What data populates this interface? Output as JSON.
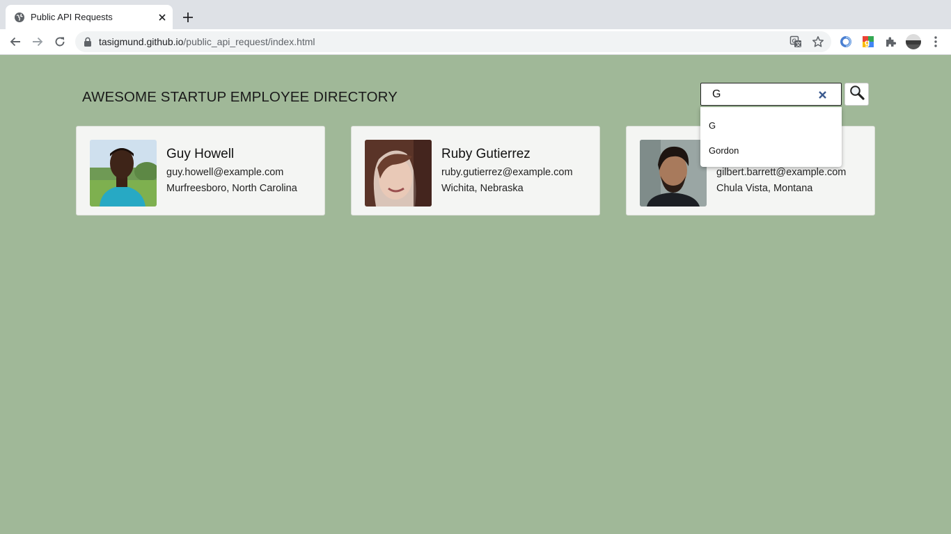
{
  "browser": {
    "tab_title": "Public API Requests",
    "url_host": "tasigmund.github.io",
    "url_path": "/public_api_request/index.html"
  },
  "page": {
    "title": "AWESOME STARTUP EMPLOYEE DIRECTORY",
    "search": {
      "value": "G",
      "suggestions": [
        "G",
        "Gordon"
      ]
    },
    "employees": [
      {
        "name": "Guy Howell",
        "email": "guy.howell@example.com",
        "location": "Murfreesboro, North Carolina"
      },
      {
        "name": "Ruby Gutierrez",
        "email": "ruby.gutierrez@example.com",
        "location": "Wichita, Nebraska"
      },
      {
        "name": "",
        "email": "gilbert.barrett@example.com",
        "location": "Chula Vista, Montana"
      }
    ]
  },
  "colors": {
    "page_background": "#a0b898",
    "card_background": "#f4f5f3",
    "tabstrip": "#dee1e6"
  },
  "icons": [
    "globe-icon",
    "close-icon",
    "plus-icon",
    "back-arrow-icon",
    "forward-arrow-icon",
    "reload-icon",
    "lock-icon",
    "translate-icon",
    "star-icon",
    "extension-icon",
    "profile-avatar-icon",
    "kebab-menu-icon",
    "search-icon",
    "clear-icon"
  ]
}
